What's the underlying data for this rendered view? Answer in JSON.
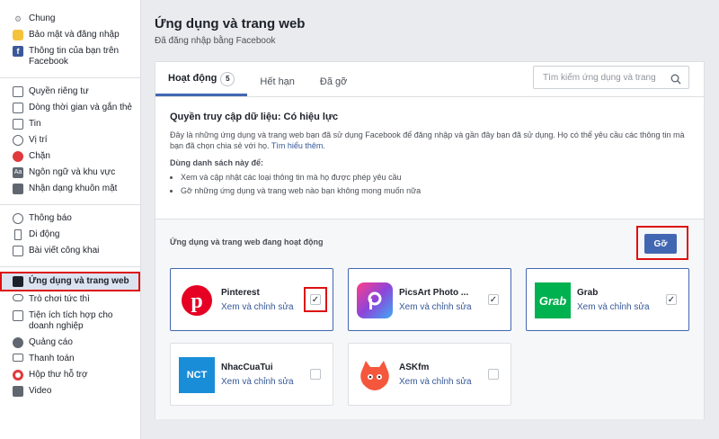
{
  "sidebar": {
    "group1": [
      {
        "label": "Chung",
        "icon": "gear-icon"
      },
      {
        "label": "Bảo mật và đăng nhập",
        "icon": "badge-icon"
      },
      {
        "label": "Thông tin của bạn trên Facebook",
        "icon": "facebook-icon"
      }
    ],
    "group2": [
      {
        "label": "Quyền riêng tư",
        "icon": "lock-icon"
      },
      {
        "label": "Dòng thời gian và gắn thẻ",
        "icon": "timeline-icon"
      },
      {
        "label": "Tin",
        "icon": "book-icon"
      },
      {
        "label": "Vị trí",
        "icon": "location-icon"
      },
      {
        "label": "Chặn",
        "icon": "block-icon"
      },
      {
        "label": "Ngôn ngữ và khu vực",
        "icon": "language-icon"
      },
      {
        "label": "Nhận dạng khuôn mặt",
        "icon": "face-icon"
      }
    ],
    "group3": [
      {
        "label": "Thông báo",
        "icon": "globe-icon"
      },
      {
        "label": "Di động",
        "icon": "mobile-icon"
      },
      {
        "label": "Bài viết công khai",
        "icon": "rss-icon"
      }
    ],
    "group4": [
      {
        "label": "Ứng dụng và trang web",
        "icon": "apps-icon"
      },
      {
        "label": "Trò chơi tức thì",
        "icon": "gamepad-icon"
      },
      {
        "label": "Tiện ích tích hợp cho doanh nghiệp",
        "icon": "business-icon"
      },
      {
        "label": "Quảng cáo",
        "icon": "ads-icon"
      },
      {
        "label": "Thanh toán",
        "icon": "card-icon"
      },
      {
        "label": "Hộp thư hỗ trợ",
        "icon": "lifebuoy-icon"
      },
      {
        "label": "Video",
        "icon": "film-icon"
      }
    ]
  },
  "header": {
    "title": "Ứng dụng và trang web",
    "subtitle": "Đã đăng nhập bằng Facebook"
  },
  "tabs": {
    "active": "Hoạt động",
    "active_count": "5",
    "expired": "Hết hạn",
    "removed": "Đã gỡ"
  },
  "search": {
    "placeholder": "Tìm kiếm ứng dụng và trang"
  },
  "info": {
    "heading": "Quyền truy cập dữ liệu: Có hiệu lực",
    "description": "Đây là những ứng dụng và trang web bạn đã sử dụng Facebook để đăng nhập và gần đây bạn đã sử dụng. Họ có thể yêu cầu các thông tin mà bạn đã chọn chia sẻ với họ.",
    "learn_more": "Tìm hiểu thêm.",
    "use_list_label": "Dùng danh sách này để:",
    "bullets": [
      "Xem và cập nhật các loại thông tin mà họ được phép yêu cầu",
      "Gỡ những ứng dụng và trang web nào bạn không mong muốn nữa"
    ]
  },
  "active_apps": {
    "label": "Ứng dụng và trang web đang hoạt động",
    "remove_button": "Gỡ",
    "apps": [
      {
        "name": "Pinterest",
        "link": "Xem và chỉnh sửa",
        "checked": true,
        "color": "#e60023"
      },
      {
        "name": "PicsArt Photo ...",
        "link": "Xem và chỉnh sửa",
        "checked": true,
        "color": "#8e44d9"
      },
      {
        "name": "Grab",
        "link": "Xem và chỉnh sửa",
        "checked": true,
        "color": "#00b14f",
        "logo_text": "Grab"
      },
      {
        "name": "NhacCuaTui",
        "link": "Xem và chỉnh sửa",
        "checked": false,
        "color": "#1a8dd8",
        "logo_text": "NCT"
      },
      {
        "name": "ASKfm",
        "link": "Xem và chỉnh sửa",
        "checked": false,
        "color": "#f4573c"
      }
    ]
  }
}
